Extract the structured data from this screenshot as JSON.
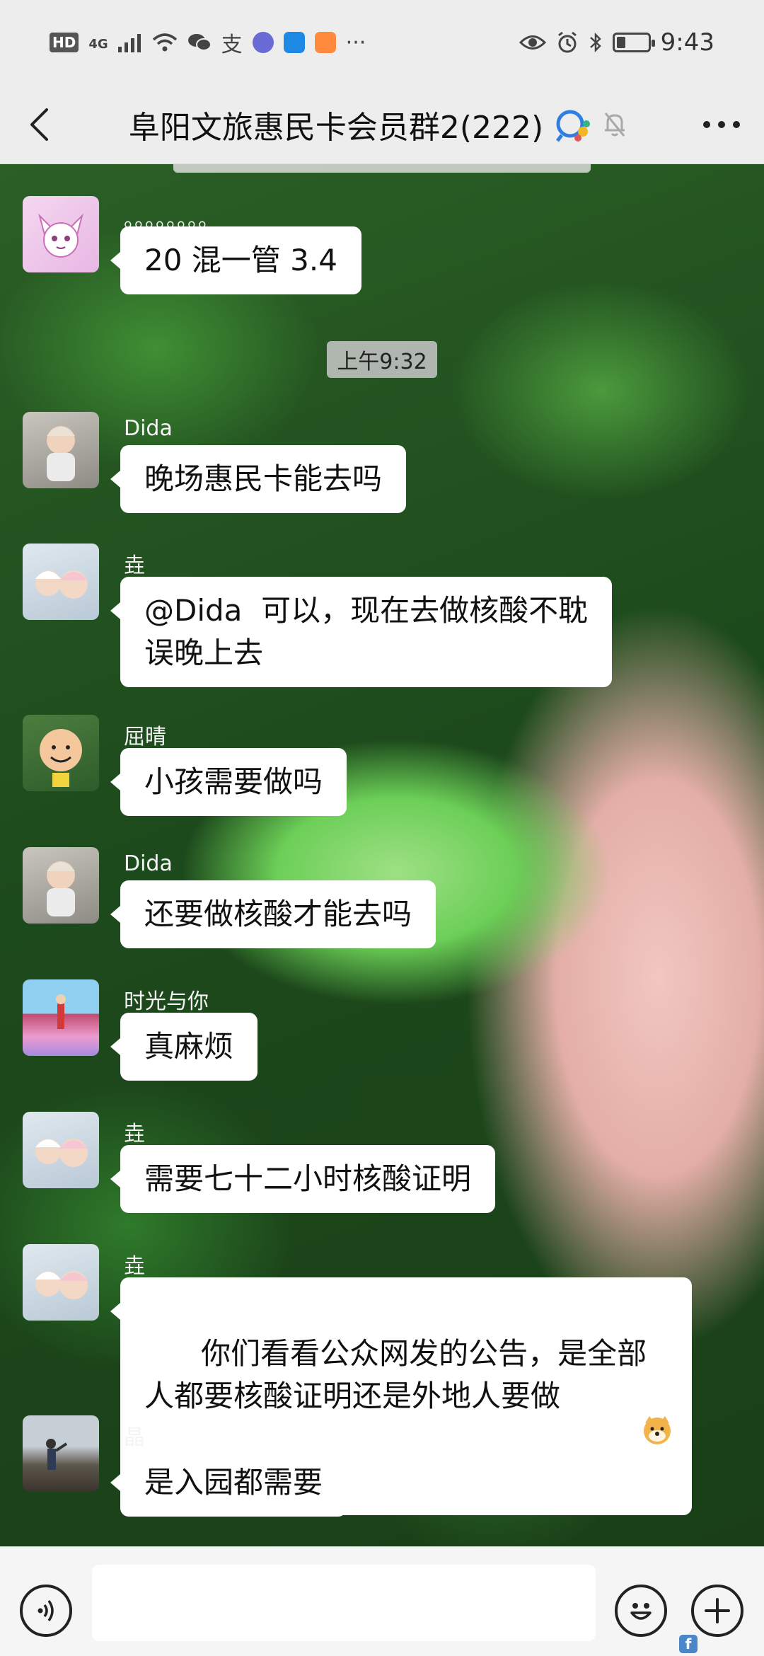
{
  "status_bar": {
    "network_badge": "HD",
    "signal_label": "4G",
    "more_dots": "···",
    "time": "9:43"
  },
  "nav": {
    "title": "阜阳文旅惠民卡会员群2(222)"
  },
  "chat": {
    "timestamp": "上午9:32",
    "messages": [
      {
        "sender": "。。。。。。。。",
        "text": "20 混一管 3.4"
      },
      {
        "sender": "Dida",
        "text": "晚场惠民卡能去吗"
      },
      {
        "sender": "垚",
        "text": "@Dida  可以，现在去做核酸不耽\n误晚上去"
      },
      {
        "sender": "屈晴",
        "text": "小孩需要做吗"
      },
      {
        "sender": "Dida",
        "text": "还要做核酸才能去吗"
      },
      {
        "sender": "时光与你",
        "text": "真麻烦"
      },
      {
        "sender": "垚",
        "text": "需要七十二小时核酸证明"
      },
      {
        "sender": "垚",
        "text": "你们看看公众网发的公告，是全部\n人都要核酸证明还是外地人要做"
      },
      {
        "sender": "晶",
        "text": "是入园都需要"
      }
    ]
  },
  "input": {
    "value": "",
    "placeholder": ""
  },
  "icons": {
    "back": "chevron-left-icon",
    "more": "more-horizontal-icon",
    "voice": "voice-icon",
    "emoji": "emoji-icon",
    "add": "plus-icon",
    "mute": "bell-off-icon"
  },
  "colors": {
    "bubble": "#ffffff",
    "bar_background": "#ededed"
  }
}
